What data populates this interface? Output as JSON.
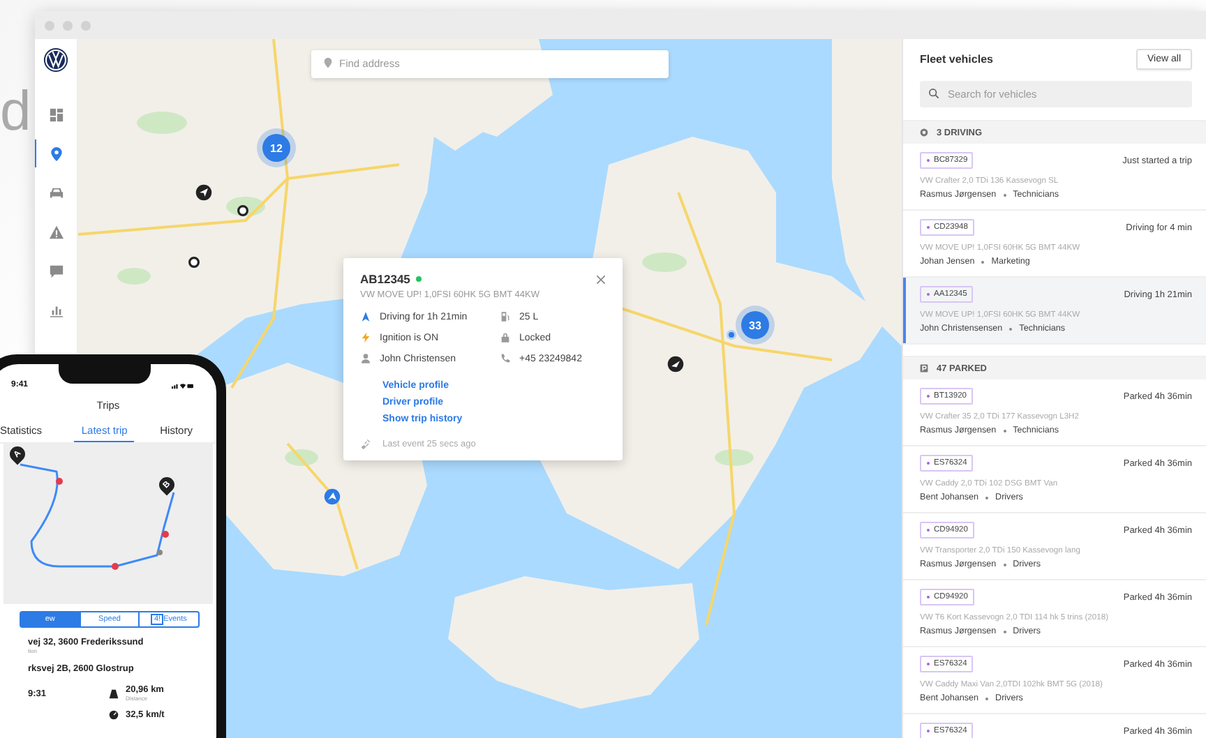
{
  "background_text": "d",
  "nav": [
    {
      "kind": "dashboard",
      "selected": false
    },
    {
      "kind": "location",
      "selected": true
    },
    {
      "kind": "car",
      "selected": false
    },
    {
      "kind": "warning",
      "selected": false
    },
    {
      "kind": "chat",
      "selected": false
    },
    {
      "kind": "chart",
      "selected": false
    }
  ],
  "map": {
    "search": {
      "placeholder": "Find address"
    },
    "clusters": [
      {
        "count": "12"
      },
      {
        "count": "33"
      }
    ]
  },
  "popup": {
    "plate": "AB12345",
    "online": true,
    "model": "VW MOVE UP! 1,0FSI 60HK 5G BMT 44KW",
    "details": [
      {
        "kind": "driving",
        "text": "Driving for 1h 21min"
      },
      {
        "kind": "fuel",
        "text": "25 L"
      },
      {
        "kind": "ignition",
        "text": "Ignition is ON"
      },
      {
        "kind": "lock",
        "text": "Locked"
      },
      {
        "kind": "driver",
        "text": "John Christensen"
      },
      {
        "kind": "phone",
        "text": "+45 23249842"
      }
    ],
    "links": [
      "Vehicle profile",
      "Driver profile",
      "Show trip history"
    ],
    "last_event": "Last event 25 secs ago"
  },
  "panel": {
    "title": "Fleet vehicles",
    "view_all": "View all",
    "search": {
      "placeholder": "Search for vehicles"
    },
    "groups": [
      {
        "kind": "driving",
        "label": "3 DRIVING",
        "vehicles": [
          {
            "plate": "BC87329",
            "status": "Just started a trip",
            "model": "VW Crafter 2,0 TDi 136 Kassevogn SL",
            "driver": "Rasmus Jørgensen",
            "team": "Technicians",
            "selected": false
          },
          {
            "plate": "CD23948",
            "status": "Driving for 4 min",
            "model": "VW MOVE UP! 1,0FSI 60HK 5G BMT 44KW",
            "driver": "Johan Jensen",
            "team": "Marketing",
            "selected": false
          },
          {
            "plate": "AA12345",
            "status": "Driving 1h 21min",
            "model": "VW MOVE UP! 1,0FSI 60HK 5G BMT 44KW",
            "driver": "John Christensensen",
            "team": "Technicians",
            "selected": true
          }
        ]
      },
      {
        "kind": "parked",
        "label": "47 PARKED",
        "vehicles": [
          {
            "plate": "BT13920",
            "status": "Parked 4h 36min",
            "model": "VW Crafter 35 2,0 TDi 177 Kassevogn L3H2",
            "driver": "Rasmus Jørgensen",
            "team": "Technicians",
            "selected": false
          },
          {
            "plate": "ES76324",
            "status": "Parked 4h 36min",
            "model": "VW Caddy 2,0 TDi 102 DSG BMT Van",
            "driver": "Bent Johansen",
            "team": "Drivers",
            "selected": false
          },
          {
            "plate": "CD94920",
            "status": "Parked 4h 36min",
            "model": "VW Transporter 2,0 TDi 150 Kassevogn lang",
            "driver": "Rasmus Jørgensen",
            "team": "Drivers",
            "selected": false
          },
          {
            "plate": "CD94920",
            "status": "Parked 4h 36min",
            "model": "VW T6 Kort Kassevogn 2,0 TDI 114 hk 5 trins (2018)",
            "driver": "Rasmus Jørgensen",
            "team": "Drivers",
            "selected": false
          },
          {
            "plate": "ES76324",
            "status": "Parked 4h 36min",
            "model": "VW Caddy Maxi Van 2,0TDI 102hk BMT 5G (2018)",
            "driver": "Bent Johansen",
            "team": "Drivers",
            "selected": false
          },
          {
            "plate": "ES76324",
            "status": "Parked 4h 36min"
          }
        ]
      }
    ]
  },
  "phone": {
    "time": "9:41",
    "title": "Trips",
    "tabs": [
      {
        "label": "Statistics",
        "selected": false
      },
      {
        "label": "Latest trip",
        "selected": true
      },
      {
        "label": "History",
        "selected": false
      }
    ],
    "pins": [
      "A",
      "B"
    ],
    "segments": [
      {
        "label": "ew",
        "selected": true
      },
      {
        "label": "Speed",
        "selected": false
      },
      {
        "label": "Events",
        "badge": "4!",
        "selected": false
      }
    ],
    "addresses": [
      {
        "text": "vej 32, 3600 Frederikssund",
        "sub": "tion"
      },
      {
        "text": "rksvej 2B, 2600 Glostrup"
      }
    ],
    "stats": [
      {
        "kind": "time",
        "value": "9:31"
      },
      {
        "kind": "distance",
        "value": "20,96 km",
        "label": "Distance"
      },
      {
        "kind": "speed",
        "value": "32,5 km/t"
      }
    ]
  }
}
